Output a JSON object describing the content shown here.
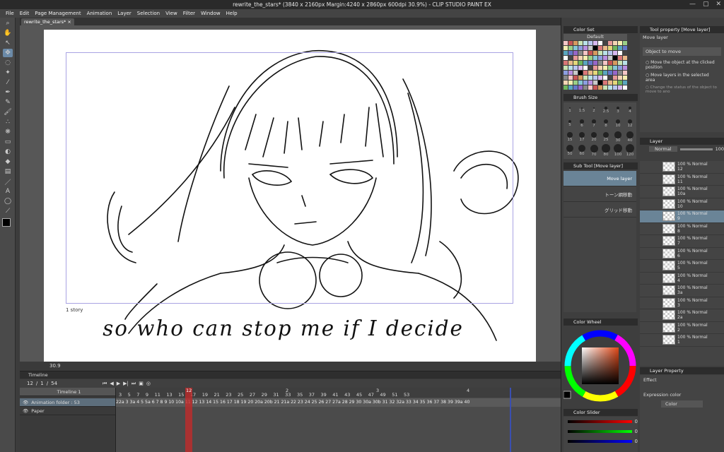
{
  "window": {
    "title": "rewrite_the_stars* (3840 x 2160px Margin:4240 x 2860px 600dpi 30.9%) - CLIP STUDIO PAINT EX"
  },
  "menu": [
    "File",
    "Edit",
    "Page Management",
    "Animation",
    "Layer",
    "Selection",
    "View",
    "Filter",
    "Window",
    "Help"
  ],
  "doc_tab": "rewrite_the_stars*",
  "canvas": {
    "story_label": "1 story",
    "caption": "so  who can  stop me if I decide",
    "zoom": "30.9"
  },
  "timeline": {
    "title": "Timeline",
    "frame_current": "12",
    "frame_sep": "/",
    "frame_start": "1",
    "frame_sep2": "/",
    "frame_total": "54",
    "track_name": "Timeline 1",
    "rows": [
      "Animation folder : 53",
      "Paper"
    ],
    "ruler": [
      "3",
      "5",
      "7",
      "9",
      "11",
      "13",
      "15",
      "17",
      "19",
      "21",
      "23",
      "25",
      "27",
      "29",
      "31",
      "33",
      "35",
      "37",
      "39",
      "41",
      "43",
      "45",
      "47",
      "49",
      "51",
      "53"
    ],
    "ruler_seconds": [
      "1",
      "2",
      "3",
      "4"
    ],
    "playhead_label": "12",
    "cells": "22a 3 3a 4 5 5a 6 7 8 9 10 10a 11 12 13 14 15 16 17 18 19 20 20a 20b 21 21a 22 23 24 25 26 27 27a 28 29 30 30a 30b 31 32 32a 33 34 35 36 37 38 39 39a 40"
  },
  "colorset": {
    "title": "Color Set",
    "preset": "Default"
  },
  "brushsize": {
    "title": "Brush Size",
    "sizes": [
      "1",
      "1.5",
      "2",
      "2.5",
      "3",
      "4",
      "5",
      "6",
      "7",
      "8",
      "10",
      "12",
      "15",
      "17",
      "20",
      "25",
      "30",
      "40",
      "50",
      "60",
      "70",
      "80",
      "100",
      "120"
    ]
  },
  "subtool": {
    "title": "Sub Tool [Move layer]",
    "items": [
      "Move layer",
      "トーン網移動",
      "グリッド移動"
    ]
  },
  "toolprop": {
    "title": "Tool property [Move layer]",
    "subtitle": "Move layer",
    "object_label": "Object to move",
    "opt1": "Move the object at the clicked position",
    "opt2": "Move layers in the selected area",
    "opt3": "Change the status of the object to move to ano"
  },
  "layer": {
    "title": "Layer",
    "blend": "Normal",
    "opacity": "100",
    "items": [
      {
        "pct": "100 % Normal",
        "name": "12"
      },
      {
        "pct": "100 % Normal",
        "name": "11"
      },
      {
        "pct": "100 % Normal",
        "name": "10a"
      },
      {
        "pct": "100 % Normal",
        "name": "10"
      },
      {
        "pct": "100 % Normal",
        "name": "9"
      },
      {
        "pct": "100 % Normal",
        "name": "8"
      },
      {
        "pct": "100 % Normal",
        "name": "7"
      },
      {
        "pct": "100 % Normal",
        "name": "6"
      },
      {
        "pct": "100 % Normal",
        "name": "5"
      },
      {
        "pct": "100 % Normal",
        "name": "4"
      },
      {
        "pct": "100 % Normal",
        "name": "3a"
      },
      {
        "pct": "100 % Normal",
        "name": "3"
      },
      {
        "pct": "100 % Normal",
        "name": "2a"
      },
      {
        "pct": "100 % Normal",
        "name": "2"
      },
      {
        "pct": "100 % Normal",
        "name": "1"
      }
    ],
    "selected_index": 4
  },
  "colorwheel": {
    "title": "Color Wheel"
  },
  "layerprop": {
    "title": "Layer Property",
    "effect_label": "Effect",
    "expr_label": "Expression color",
    "expr_value": "Color"
  },
  "colorslider": {
    "title": "Color Slider",
    "r": "0",
    "g": "0",
    "b": "0"
  },
  "colors": {
    "accent": "#6a8497",
    "playhead": "#c82828",
    "frame": "#a9a3e3"
  }
}
